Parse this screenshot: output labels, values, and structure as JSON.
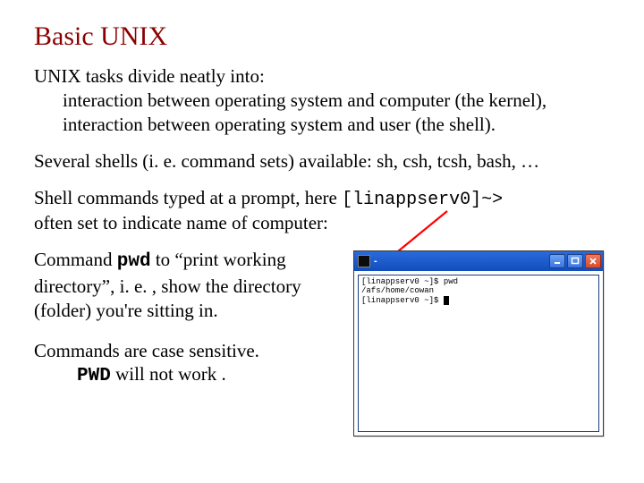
{
  "heading": "Basic UNIX",
  "intro_line": "UNIX tasks divide neatly into:",
  "intro_item1": "interaction between operating system and computer (the kernel),",
  "intro_item2": "interaction between operating system and user (the shell).",
  "shells_line": "Several shells (i. e. command sets) available: sh, csh, tcsh, bash, …",
  "prompt_pre": "Shell commands typed at a prompt, here ",
  "prompt_code": "[linappserv0]~>",
  "prompt_post": "often set to indicate name of computer:",
  "pwd_pre": "Command ",
  "pwd_cmd": "pwd",
  "pwd_post1": " to “print working",
  "pwd_line2": "directory”, i. e. , show the directory",
  "pwd_line3": "(folder) you're sitting in.",
  "case_line1": "Commands are case sensitive.",
  "case_cmd": "PWD",
  "case_post": " will not work .",
  "terminal": {
    "title": "-",
    "line1": "[linappserv0 ~]$ pwd",
    "line2": "/afs/home/cowan",
    "line3": "[linappserv0 ~]$ "
  }
}
